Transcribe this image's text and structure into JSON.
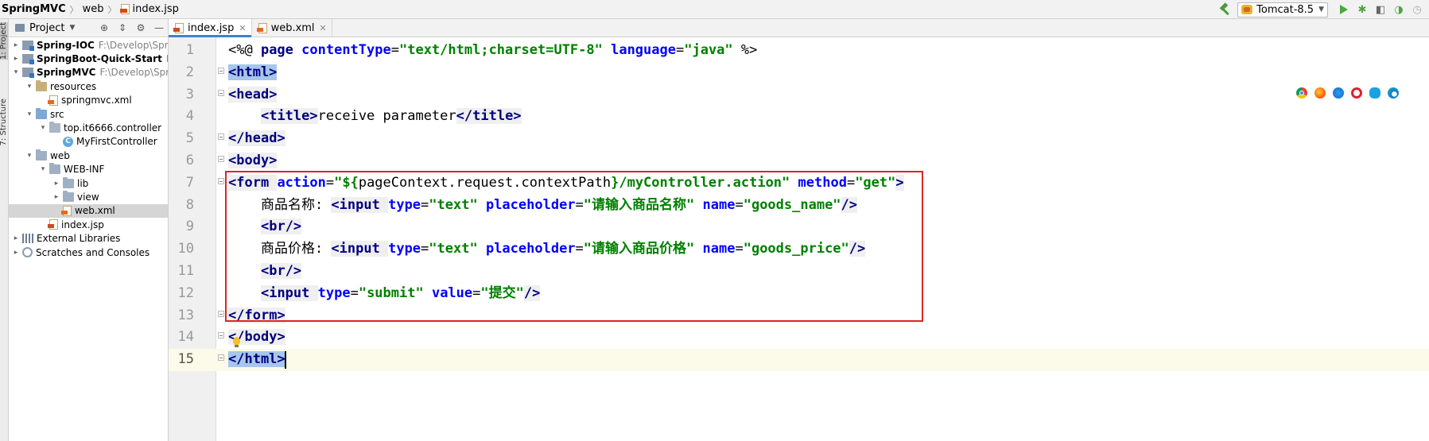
{
  "breadcrumbs": [
    "SpringMVC",
    "web",
    "index.jsp"
  ],
  "run_config": {
    "label": "Tomcat-8.5"
  },
  "colors": {
    "accent": "#4083c9",
    "highlight_box": "#e02424",
    "run_green": "#4fa53f"
  },
  "left_strip": {
    "tab_project": "1: Project",
    "tab_structure": "7: Structure"
  },
  "project_panel": {
    "title": "Project",
    "tree": [
      {
        "depth": 0,
        "arrow": "right",
        "icon": "module-icon",
        "label": "Spring-IOC",
        "bold": true,
        "path": "F:\\Develop\\Spring\\S"
      },
      {
        "depth": 0,
        "arrow": "right",
        "icon": "module-icon",
        "label": "SpringBoot-Quick-Start",
        "bold": true,
        "path": "F:\\Deve"
      },
      {
        "depth": 0,
        "arrow": "down",
        "icon": "module-icon",
        "label": "SpringMVC",
        "bold": true,
        "path": "F:\\Develop\\Spring\\S"
      },
      {
        "depth": 1,
        "arrow": "down",
        "icon": "resources-folder-icon",
        "label": "resources"
      },
      {
        "depth": 2,
        "arrow": "",
        "icon": "xml-file-icon",
        "label": "springmvc.xml"
      },
      {
        "depth": 1,
        "arrow": "down",
        "icon": "source-folder-icon",
        "label": "src"
      },
      {
        "depth": 2,
        "arrow": "down",
        "icon": "package-icon",
        "label": "top.it6666.controller"
      },
      {
        "depth": 3,
        "arrow": "",
        "icon": "class-icon",
        "label": "MyFirstController"
      },
      {
        "depth": 1,
        "arrow": "down",
        "icon": "folder-icon",
        "label": "web"
      },
      {
        "depth": 2,
        "arrow": "down",
        "icon": "folder-icon",
        "label": "WEB-INF"
      },
      {
        "depth": 3,
        "arrow": "right",
        "icon": "folder-icon",
        "label": "lib"
      },
      {
        "depth": 3,
        "arrow": "right",
        "icon": "folder-icon",
        "label": "view"
      },
      {
        "depth": 3,
        "arrow": "",
        "icon": "xml-file-icon",
        "label": "web.xml",
        "selected": true
      },
      {
        "depth": 2,
        "arrow": "",
        "icon": "jsp-file-icon",
        "label": "index.jsp"
      },
      {
        "depth": 0,
        "arrow": "right",
        "icon": "libraries-icon",
        "label": "External Libraries"
      },
      {
        "depth": 0,
        "arrow": "right",
        "icon": "scratches-icon",
        "label": "Scratches and Consoles"
      }
    ]
  },
  "editor": {
    "tabs": [
      {
        "label": "index.jsp",
        "active": true,
        "icon": "jsp-file-icon"
      },
      {
        "label": "web.xml",
        "active": false,
        "icon": "xml-file-icon"
      }
    ],
    "caret_line": 15,
    "lines": [
      {
        "n": "1",
        "tokens": [
          [
            "p",
            "<%@ "
          ],
          [
            "dir",
            "page "
          ],
          [
            "attr",
            "contentType"
          ],
          [
            "p",
            "="
          ],
          [
            "str",
            "\"text/html;charset=UTF-8\" "
          ],
          [
            "attr",
            "language"
          ],
          [
            "p",
            "="
          ],
          [
            "str",
            "\"java\" "
          ],
          [
            "p",
            "%>"
          ]
        ]
      },
      {
        "n": "2",
        "tokens": [
          [
            "hl",
            "<html>"
          ]
        ]
      },
      {
        "n": "3",
        "tokens": [
          [
            "tb",
            "<"
          ],
          [
            "tagb",
            "head"
          ],
          [
            "tb",
            ">"
          ]
        ]
      },
      {
        "n": "4",
        "tokens": [
          [
            "p",
            "    "
          ],
          [
            "tb",
            "<"
          ],
          [
            "tagb",
            "title"
          ],
          [
            "tb",
            ">"
          ],
          [
            "p",
            "receive parameter"
          ],
          [
            "tb",
            "</"
          ],
          [
            "tagb",
            "title"
          ],
          [
            "tb",
            ">"
          ]
        ]
      },
      {
        "n": "5",
        "tokens": [
          [
            "tb",
            "</"
          ],
          [
            "tagb",
            "head"
          ],
          [
            "tb",
            ">"
          ]
        ]
      },
      {
        "n": "6",
        "tokens": [
          [
            "tb",
            "<"
          ],
          [
            "tagb",
            "body"
          ],
          [
            "tb",
            ">"
          ]
        ]
      },
      {
        "n": "7",
        "tokens": [
          [
            "tb",
            "<"
          ],
          [
            "tagb",
            "form "
          ],
          [
            "attr",
            "action"
          ],
          [
            "p",
            "="
          ],
          [
            "str",
            "\"${"
          ],
          [
            "p",
            "pageContext.request.contextPath"
          ],
          [
            "str",
            "}/myController.action\" "
          ],
          [
            "attr",
            "method"
          ],
          [
            "p",
            "="
          ],
          [
            "str",
            "\"get\""
          ],
          [
            "tb",
            ">"
          ]
        ]
      },
      {
        "n": "8",
        "tokens": [
          [
            "p",
            "    商品名称: "
          ],
          [
            "tb",
            "<"
          ],
          [
            "tagb",
            "input "
          ],
          [
            "attr",
            "type"
          ],
          [
            "p",
            "="
          ],
          [
            "str",
            "\"text\" "
          ],
          [
            "attr",
            "placeholder"
          ],
          [
            "p",
            "="
          ],
          [
            "str",
            "\"请输入商品名称\" "
          ],
          [
            "attr",
            "name"
          ],
          [
            "p",
            "="
          ],
          [
            "str",
            "\"goods_name\""
          ],
          [
            "tb",
            "/>"
          ]
        ]
      },
      {
        "n": "9",
        "tokens": [
          [
            "p",
            "    "
          ],
          [
            "tb",
            "<"
          ],
          [
            "tagb",
            "br"
          ],
          [
            "tb",
            "/>"
          ]
        ]
      },
      {
        "n": "10",
        "tokens": [
          [
            "p",
            "    商品价格: "
          ],
          [
            "tb",
            "<"
          ],
          [
            "tagb",
            "input "
          ],
          [
            "attr",
            "type"
          ],
          [
            "p",
            "="
          ],
          [
            "str",
            "\"text\" "
          ],
          [
            "attr",
            "placeholder"
          ],
          [
            "p",
            "="
          ],
          [
            "str",
            "\"请输入商品价格\" "
          ],
          [
            "attr",
            "name"
          ],
          [
            "p",
            "="
          ],
          [
            "str",
            "\"goods_price\""
          ],
          [
            "tb",
            "/>"
          ]
        ]
      },
      {
        "n": "11",
        "tokens": [
          [
            "p",
            "    "
          ],
          [
            "tb",
            "<"
          ],
          [
            "tagb",
            "br"
          ],
          [
            "tb",
            "/>"
          ]
        ]
      },
      {
        "n": "12",
        "tokens": [
          [
            "p",
            "    "
          ],
          [
            "tb",
            "<"
          ],
          [
            "tagb",
            "input "
          ],
          [
            "attr",
            "type"
          ],
          [
            "p",
            "="
          ],
          [
            "str",
            "\"submit\" "
          ],
          [
            "attr",
            "value"
          ],
          [
            "p",
            "="
          ],
          [
            "str",
            "\"提交\""
          ],
          [
            "tb",
            "/>"
          ]
        ]
      },
      {
        "n": "13",
        "tokens": [
          [
            "tb",
            "</"
          ],
          [
            "tagb",
            "form"
          ],
          [
            "tb",
            ">"
          ]
        ]
      },
      {
        "n": "14",
        "tokens": [
          [
            "tb",
            "</"
          ],
          [
            "tagb",
            "body"
          ],
          [
            "tb",
            ">"
          ]
        ]
      },
      {
        "n": "15",
        "tokens": [
          [
            "hl",
            "</html>"
          ]
        ]
      }
    ]
  },
  "browser_icons": [
    "chrome-icon",
    "firefox-icon",
    "safari-icon",
    "opera-icon",
    "internet-explorer-icon",
    "edge-icon"
  ]
}
